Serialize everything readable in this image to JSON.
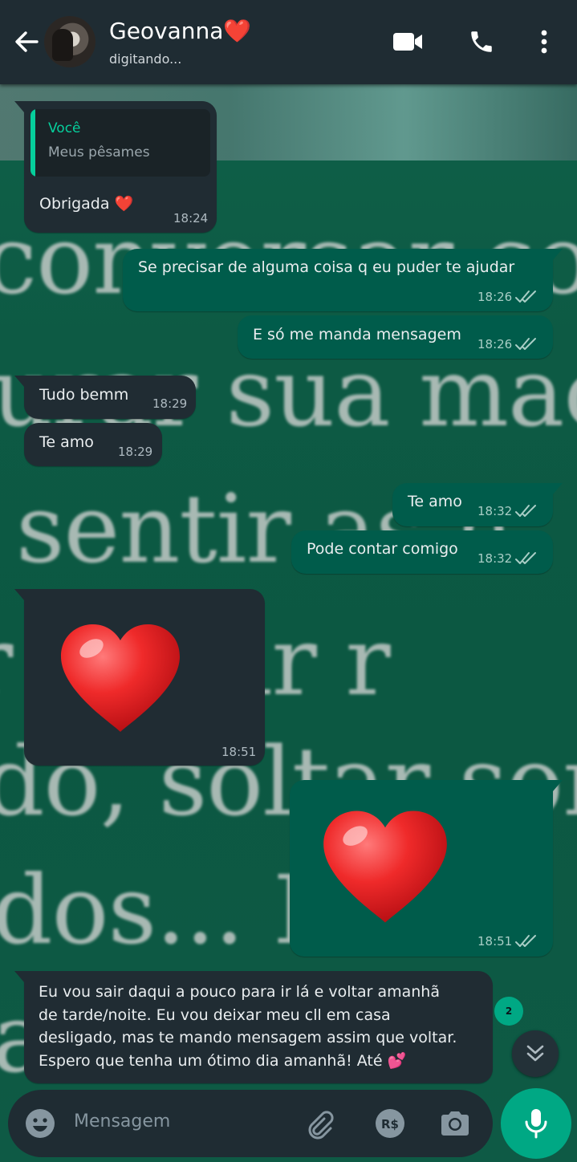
{
  "header": {
    "contact_name": "Geovanna❤️",
    "status": "digitando...",
    "icons": [
      "back-arrow-icon",
      "video-call-icon",
      "phone-call-icon",
      "more-options-icon"
    ]
  },
  "wallpaper": {
    "lines": [
      "conversar con",
      "urar sua mac",
      "sentir as h",
      "r sentir r",
      "do, soltar sor",
      "dos... E r",
      "a"
    ]
  },
  "messages": [
    {
      "direction": "in",
      "quote_author": "Você",
      "quote_text": "Meus pêsames",
      "text": "Obrigada ❤️",
      "time": "18:24"
    },
    {
      "direction": "out",
      "text": "Se precisar de alguma coisa q eu puder te ajudar",
      "time": "18:26",
      "status": "read"
    },
    {
      "direction": "out",
      "text": "E só me manda mensagem",
      "time": "18:26",
      "status": "read"
    },
    {
      "direction": "in",
      "text": "Tudo bemm",
      "time": "18:29"
    },
    {
      "direction": "in",
      "text": "Te amo",
      "time": "18:29"
    },
    {
      "direction": "out",
      "text": "Te amo",
      "time": "18:32",
      "status": "read"
    },
    {
      "direction": "out",
      "text": "Pode contar comigo",
      "time": "18:32",
      "status": "read"
    },
    {
      "direction": "in",
      "emoji": "❤️",
      "time": "18:51"
    },
    {
      "direction": "out",
      "emoji": "❤️",
      "time": "18:51",
      "status": "read"
    },
    {
      "direction": "in",
      "lines": [
        "Eu vou sair daqui a pouco para ir lá e voltar amanhã",
        "de tarde/noite. Eu vou deixar meu cll em casa",
        "desligado, mas te mando mensagem assim que voltar.",
        "Espero que tenha um ótimo dia amanhã! Até 💕"
      ]
    }
  ],
  "unread_count": "2",
  "composer": {
    "placeholder": "Mensagem",
    "icons": [
      "emoji-icon",
      "attach-icon",
      "payment-icon",
      "camera-icon",
      "mic-icon"
    ]
  },
  "colors": {
    "header": "#1f2c33",
    "incoming_bubble": "#202c33",
    "outgoing_bubble": "#005c4b",
    "accent": "#00a884"
  }
}
